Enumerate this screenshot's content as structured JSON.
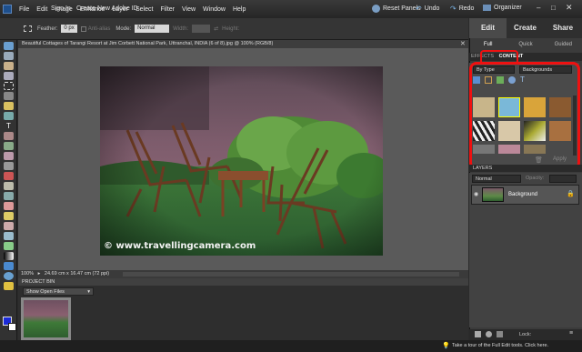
{
  "menubar": {
    "items": [
      "File",
      "Edit",
      "Image",
      "Enhance",
      "Layer",
      "Select",
      "Filter",
      "View",
      "Window",
      "Help"
    ],
    "sign_in": "Sign In",
    "create_id": "Create New Adobe ID",
    "reset_panels": "Reset Panels",
    "undo": "Undo",
    "redo": "Redo",
    "organizer": "Organizer"
  },
  "options": {
    "feather_label": "Feather:",
    "feather_value": "0 px",
    "anti_alias": "Anti-alias",
    "mode_label": "Mode:",
    "mode_value": "Normal",
    "width_label": "Width:",
    "height_label": "Height:"
  },
  "document": {
    "tab_title": "Beautiful Cottages of Tarangi Resort at Jim Corbett National Park, Uttranchal, INDIA (6 of 8).jpg @ 100% (RGB/8)",
    "watermark": "© www.travellingcamera.com",
    "zoom": "100%",
    "dimensions": "24.69 cm x 16.47 cm (72 ppi)"
  },
  "project_bin": {
    "header": "PROJECT BIN",
    "selector": "Show Open Files"
  },
  "right_panel": {
    "tabs": [
      "Edit",
      "Create",
      "Share"
    ],
    "subtabs": [
      "Full",
      "Quick",
      "Guided"
    ],
    "effects_label": "EFFECTS",
    "content_label": "CONTENT",
    "filter_by": "By Type",
    "category": "Backgrounds",
    "apply_button": "Apply",
    "layers_header": "LAYERS",
    "blend_mode": "Normal",
    "opacity_label": "Opacity:",
    "layer_name": "Background",
    "lock_label": "Lock:"
  },
  "status": {
    "tour_text": "Take a tour of the Full Edit tools. Click here."
  },
  "colors": {
    "highlight_red": "#e11111",
    "accent_blue": "#3a6ea5"
  }
}
